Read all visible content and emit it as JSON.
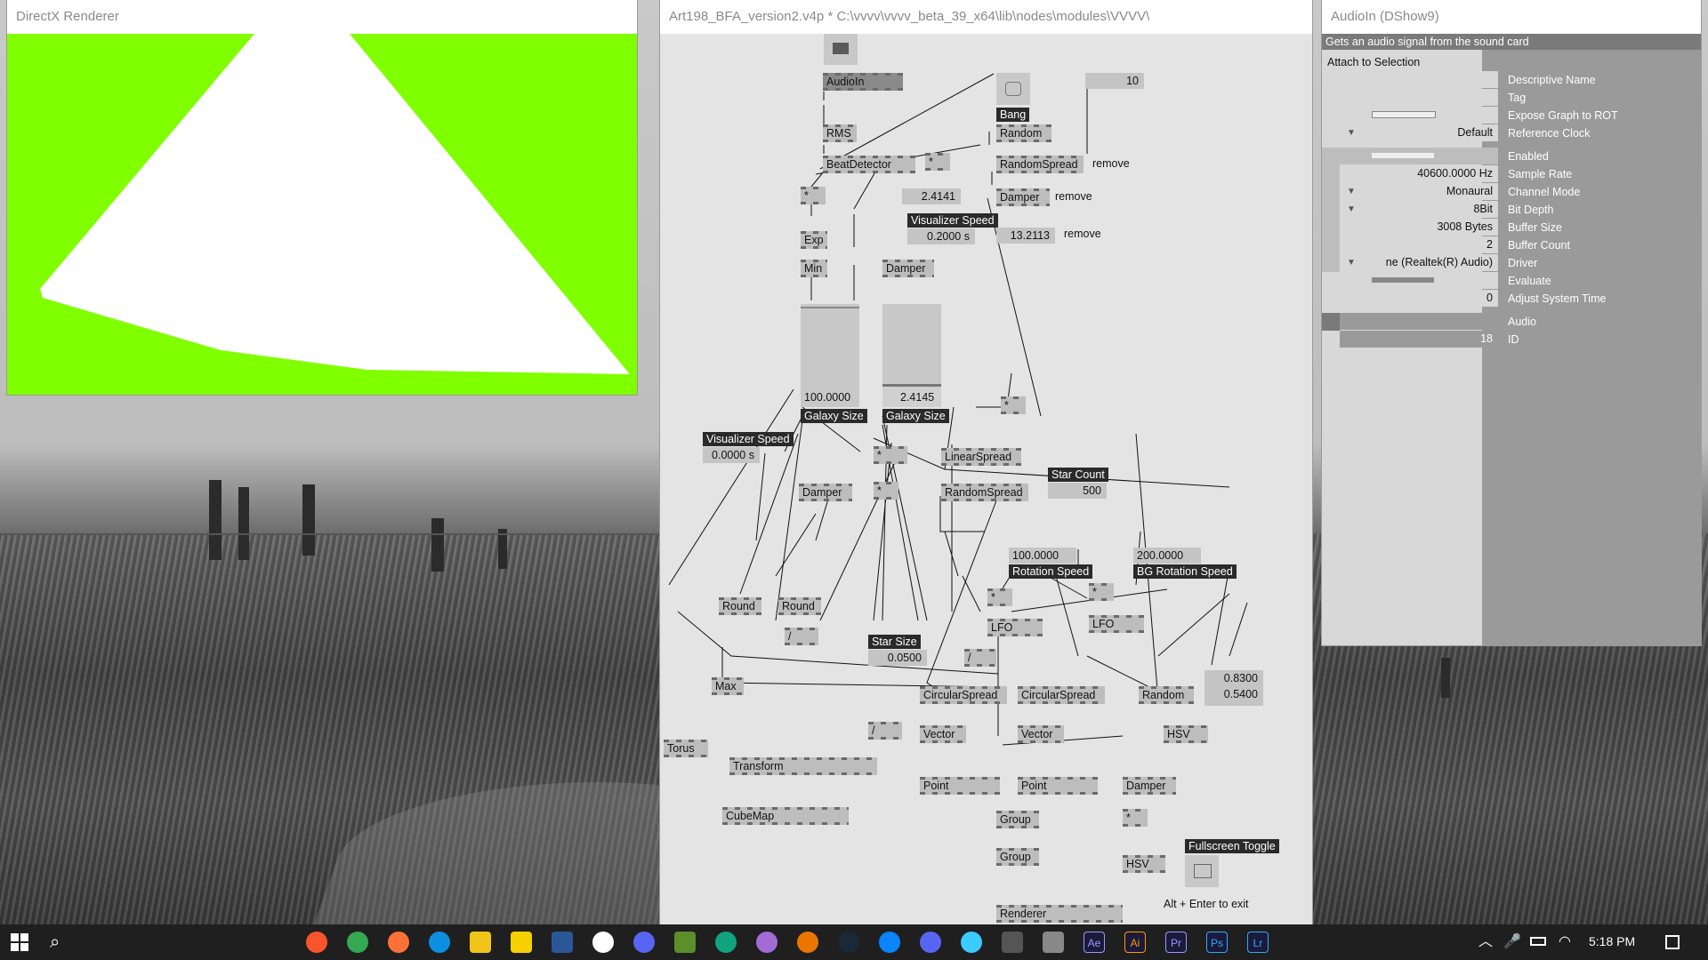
{
  "desktop": {
    "wallpaper": "fence-field-bw"
  },
  "renderer_window": {
    "title": "DirectX Renderer",
    "bg_color": "#7fff00",
    "shape_color": "#ffffff"
  },
  "patch_window": {
    "title": "Art198_BFA_version2.v4p *  C:\\vvvv\\vvvv_beta_39_x64\\lib\\nodes\\modules\\VVVV\\",
    "nodes": {
      "audioin": "AudioIn",
      "rms": "RMS",
      "beatdetector": "BeatDetector",
      "bang": "Bang",
      "random1": "Random",
      "randomspread1": "RandomSpread",
      "damper_top": "Damper",
      "damper_mid": "Damper",
      "exp": "Exp",
      "min": "Min",
      "damper_left": "Damper",
      "linearspread": "LinearSpread",
      "randomspread2": "RandomSpread",
      "round1": "Round",
      "round2": "Round",
      "max": "Max",
      "torus": "Torus",
      "transform": "Transform",
      "cubemap": "CubeMap",
      "lfo1": "LFO",
      "lfo2": "LFO",
      "circularspread1": "CircularSpread",
      "circularspread2": "CircularSpread",
      "vector1": "Vector",
      "vector2": "Vector",
      "point1": "Point",
      "point2": "Point",
      "random2": "Random",
      "hsv1": "HSV",
      "damper_right": "Damper",
      "hsv2": "HSV",
      "group1": "Group",
      "group2": "Group",
      "renderer": "Renderer",
      "mult": "*",
      "div": "/"
    },
    "values": {
      "ten": "10",
      "v24141": "2.4141",
      "vis_speed_top": "0.2000 s",
      "v132113": "13.2113",
      "galaxy1": "100.0000",
      "galaxy2": "2.4145",
      "vis_speed_left": "0.0000 s",
      "star_count": "500",
      "rot_speed": "100.0000",
      "bg_rot_speed": "200.0000",
      "star_size": "0.0500",
      "color_a": "0.8300",
      "color_b": "0.5400"
    },
    "labels": {
      "remove": "remove",
      "visualizer_speed": "Visualizer Speed",
      "galaxy_size": "Galaxy Size",
      "star_count": "Star Count",
      "rotation_speed": "Rotation Speed",
      "bg_rotation_speed": "BG Rotation Speed",
      "star_size": "Star Size",
      "fullscreen_toggle": "Fullscreen Toggle",
      "alt_enter": "Alt + Enter to exit"
    },
    "galaxy_fill": [
      0.0,
      0.2
    ]
  },
  "inspector": {
    "title": "AudioIn (DShow9)",
    "description": "Gets an audio signal from the sound card",
    "attach": "Attach to Selection",
    "rows": [
      {
        "value": "",
        "name": "Descriptive Name"
      },
      {
        "value": "",
        "name": "Tag"
      },
      {
        "value": "",
        "name": "Expose Graph to ROT"
      },
      {
        "value": "Default",
        "name": "Reference Clock"
      },
      {
        "value": "",
        "name": "Enabled"
      },
      {
        "value": "40600.0000 Hz",
        "name": "Sample Rate"
      },
      {
        "value": "Monaural",
        "name": "Channel Mode"
      },
      {
        "value": "8Bit",
        "name": "Bit Depth"
      },
      {
        "value": "3008 Bytes",
        "name": "Buffer Size"
      },
      {
        "value": "2",
        "name": "Buffer Count"
      },
      {
        "value": "ne (Realtek(R) Audio)",
        "name": "Driver"
      },
      {
        "value": "",
        "name": "Evaluate"
      },
      {
        "value": "0",
        "name": "Adjust System Time"
      },
      {
        "value": "",
        "name": "Audio"
      },
      {
        "value": "18",
        "name": "ID"
      }
    ]
  },
  "taskbar": {
    "time": "5:18 PM",
    "apps": [
      "brave-icon",
      "chrome-icon",
      "firefox-icon",
      "edge-icon",
      "explorer-icon",
      "sticky-notes-icon",
      "word-icon",
      "unity-icon",
      "game-icon",
      "minecraft-icon",
      "chatgpt-icon",
      "app-icon",
      "blender-icon",
      "steam-icon",
      "app2-icon",
      "discord-icon",
      "krita-icon",
      "obs-icon",
      "vvvv-icon",
      "after-effects-icon",
      "illustrator-icon",
      "premiere-icon",
      "photoshop-icon",
      "lightroom-icon"
    ],
    "app_colors": [
      "#fb542b",
      "#34a853",
      "#ff7139",
      "#0c8fe0",
      "#f0c419",
      "#f7d100",
      "#2b579a",
      "#ffffff",
      "#5865f2",
      "#5a8f29",
      "#10a37f",
      "#a26bd6",
      "#ea7600",
      "#1b2838",
      "#0a84ff",
      "#5865f2",
      "#3bcbff",
      "#555555",
      "#888888",
      "#9999ff",
      "#ff9a00",
      "#9999ff",
      "#31a8ff",
      "#31a8ff"
    ],
    "ae_text": "Ae",
    "ai_text": "Ai",
    "pr_text": "Pr",
    "ps_text": "Ps",
    "lr_text": "Lr"
  }
}
